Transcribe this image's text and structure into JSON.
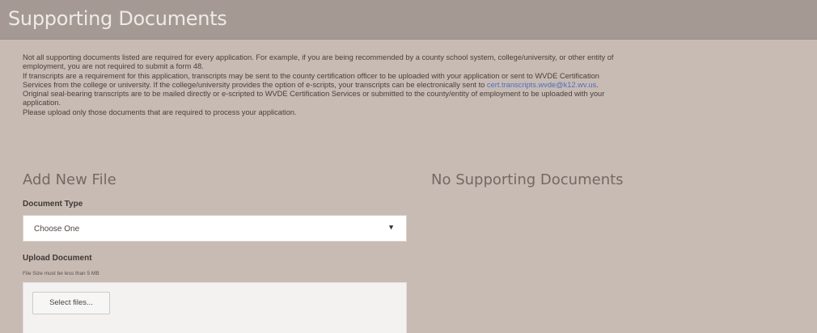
{
  "header": {
    "title": "Supporting Documents"
  },
  "intro": {
    "line1": "Not all supporting documents listed are required for every application. For example, if you are being recommended by a county school system, college/university, or other entity of",
    "line2": "employment, you are not required to submit a form 48.",
    "line3": "If transcripts are a requirement for this application, transcripts may be sent to the county certification officer to be uploaded with your application or sent to WVDE Certification",
    "line4_prefix": "Services from the college or university. If the college/university provides the option of e-scripts, your transcripts can be electronically sent to ",
    "line4_link": "cert.transcripts.wvde@k12.wv.us",
    "line4_suffix": ".",
    "line5": "Original seal-bearing transcripts are to be mailed directly or e-scripted to WVDE Certification Services or submitted to the county/entity of employment to be uploaded with your",
    "line6": "application.",
    "line7": "Please upload only those documents that are required to process your application."
  },
  "add_file": {
    "title": "Add New File",
    "document_type_label": "Document Type",
    "document_type_value": "Choose One",
    "dropdown_icon": "caret-down-icon",
    "upload_label": "Upload Document",
    "size_hint": "File Size must be less than 5 MB",
    "select_files_label": "Select files..."
  },
  "documents_list": {
    "empty_title": "No Supporting Documents"
  }
}
